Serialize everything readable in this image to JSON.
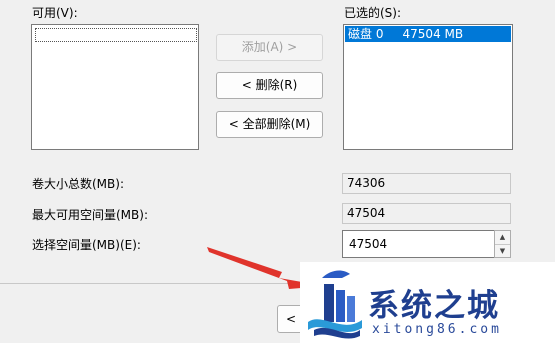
{
  "available": {
    "label": "可用(V):"
  },
  "selected": {
    "label": "已选的(S):",
    "items": [
      {
        "disk": "磁盘 0",
        "size": "47504 MB"
      }
    ]
  },
  "buttons": {
    "add": "添加(A) >",
    "remove": "< 删除(R)",
    "remove_all": "< 全部删除(M)"
  },
  "fields": {
    "total_size_label": "卷大小总数(MB):",
    "total_size_value": "74306",
    "max_space_label": "最大可用空间量(MB):",
    "max_space_value": "47504",
    "select_space_label": "选择空间量(MB)(E):",
    "select_space_value": "47504"
  },
  "footer": {
    "back_label": "<"
  },
  "watermark": {
    "title": "系统之城",
    "subtitle": "xitong86.com"
  },
  "colors": {
    "selection": "#0078d7",
    "watermark_blue": "#1f3f8f",
    "arrow": "#e0342c"
  }
}
